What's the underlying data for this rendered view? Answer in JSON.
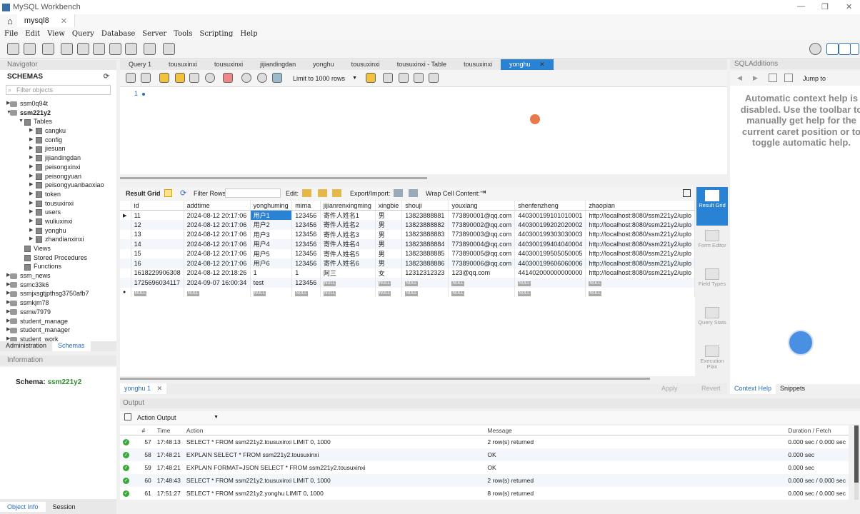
{
  "app": {
    "title": "MySQL Workbench",
    "connection_tab": "mysql8"
  },
  "menu": [
    "File",
    "Edit",
    "View",
    "Query",
    "Database",
    "Server",
    "Tools",
    "Scripting",
    "Help"
  ],
  "navigator": {
    "header": "Navigator",
    "schemas_label": "SCHEMAS",
    "filter_placeholder": "Filter objects",
    "schemas_before": [
      "ssm0q94t"
    ],
    "active_schema": "ssm221y2",
    "tables_label": "Tables",
    "tables": [
      "cangku",
      "config",
      "jiesuan",
      "jijiandingdan",
      "peisongxinxi",
      "peisongyuan",
      "peisongyuanbaoxiao",
      "token",
      "tousuxinxi",
      "users",
      "wuliuxinxi",
      "yonghu",
      "zhandianxinxi"
    ],
    "views_label": "Views",
    "procedures_label": "Stored Procedures",
    "functions_label": "Functions",
    "schemas_after": [
      "ssm_news",
      "ssmc33k6",
      "ssmjxsgtjpthsg3750afb7",
      "ssmkjm78",
      "ssmw7979",
      "student_manage",
      "student_manager",
      "student_work"
    ],
    "tabs": [
      "Administration",
      "Schemas"
    ]
  },
  "information": {
    "header": "Information",
    "schema_label": "Schema:",
    "schema_value": "ssm221y2"
  },
  "bottom_tabs": [
    "Object Info",
    "Session"
  ],
  "query_tabs": [
    "Query 1",
    "tousuxinxi",
    "tousuxinxi",
    "jijiandingdan",
    "yonghu",
    "tousuxinxi",
    "tousuxinxi - Table",
    "tousuxinxi",
    "yonghu"
  ],
  "editor_toolbar": {
    "limit": "Limit to 1000 rows"
  },
  "editor": {
    "line_number": "1"
  },
  "result_toolbar": {
    "result_grid": "Result Grid",
    "filter_rows": "Filter Rows:",
    "edit": "Edit:",
    "export_import": "Export/Import:",
    "wrap": "Wrap Cell Content:"
  },
  "grid": {
    "columns": [
      "id",
      "addtime",
      "yonghuming",
      "mima",
      "jijianrenxingming",
      "xingbie",
      "shouji",
      "youxiang",
      "shenfenzheng",
      "zhaopian"
    ],
    "rows": [
      [
        "11",
        "2024-08-12 20:17:06",
        "用户1",
        "123456",
        "寄件人姓名1",
        "男",
        "13823888881",
        "773890001@qq.com",
        "440300199101010001",
        "http://localhost:8080/ssm221y2/uplo"
      ],
      [
        "12",
        "2024-08-12 20:17:06",
        "用户2",
        "123456",
        "寄件人姓名2",
        "男",
        "13823888882",
        "773890002@qq.com",
        "440300199202020002",
        "http://localhost:8080/ssm221y2/uplo"
      ],
      [
        "13",
        "2024-08-12 20:17:06",
        "用户3",
        "123456",
        "寄件人姓名3",
        "男",
        "13823888883",
        "773890003@qq.com",
        "440300199303030003",
        "http://localhost:8080/ssm221y2/uplo"
      ],
      [
        "14",
        "2024-08-12 20:17:06",
        "用户4",
        "123456",
        "寄件人姓名4",
        "男",
        "13823888884",
        "773890004@qq.com",
        "440300199404040004",
        "http://localhost:8080/ssm221y2/uplo"
      ],
      [
        "15",
        "2024-08-12 20:17:06",
        "用户5",
        "123456",
        "寄件人姓名5",
        "男",
        "13823888885",
        "773890005@qq.com",
        "440300199505050005",
        "http://localhost:8080/ssm221y2/uplo"
      ],
      [
        "16",
        "2024-08-12 20:17:06",
        "用户6",
        "123456",
        "寄件人姓名6",
        "男",
        "13823888886",
        "773890006@qq.com",
        "440300199606060006",
        "http://localhost:8080/ssm221y2/uplo"
      ],
      [
        "1618229906308",
        "2024-08-12 20:18:26",
        "1",
        "1",
        "阿三",
        "女",
        "12312312323",
        "123@qq.com",
        "441402000000000000",
        "http://localhost:8080/ssm221y2/uplo"
      ],
      [
        "1725696034117",
        "2024-09-07 16:00:34",
        "test",
        "123456",
        "NULL",
        "NULL",
        "NULL",
        "NULL",
        "NULL",
        "NULL"
      ]
    ],
    "null_label": "NULL"
  },
  "side_panel": [
    "Result Grid",
    "Form Editor",
    "Field Types",
    "Query Stats",
    "Execution Plan"
  ],
  "result_tab": "yonghu 1",
  "apply_label": "Apply",
  "revert_label": "Revert",
  "output": {
    "header": "Output",
    "mode": "Action Output",
    "columns": [
      "#",
      "Time",
      "Action",
      "Message",
      "Duration / Fetch"
    ],
    "rows": [
      [
        "57",
        "17:48:13",
        "SELECT * FROM ssm221y2.tousuxinxi LIMIT 0, 1000",
        "2 row(s) returned",
        "0.000 sec / 0.000 sec"
      ],
      [
        "58",
        "17:48:21",
        "EXPLAIN SELECT * FROM ssm221y2.tousuxinxi",
        "OK",
        "0.000 sec"
      ],
      [
        "59",
        "17:48:21",
        "EXPLAIN FORMAT=JSON SELECT * FROM ssm221y2.tousuxinxi",
        "OK",
        "0.000 sec"
      ],
      [
        "60",
        "17:48:43",
        "SELECT * FROM ssm221y2.tousuxinxi LIMIT 0, 1000",
        "2 row(s) returned",
        "0.000 sec / 0.000 sec"
      ],
      [
        "61",
        "17:51:27",
        "SELECT * FROM ssm221y2.yonghu LIMIT 0, 1000",
        "8 row(s) returned",
        "0.000 sec / 0.000 sec"
      ]
    ]
  },
  "sql_additions": {
    "header": "SQLAdditions",
    "jump_to": "Jump to",
    "help_text": "Automatic context help is disabled. Use the toolbar to manually get help for the current caret position or to toggle automatic help.",
    "tabs": [
      "Context Help",
      "Snippets"
    ]
  }
}
